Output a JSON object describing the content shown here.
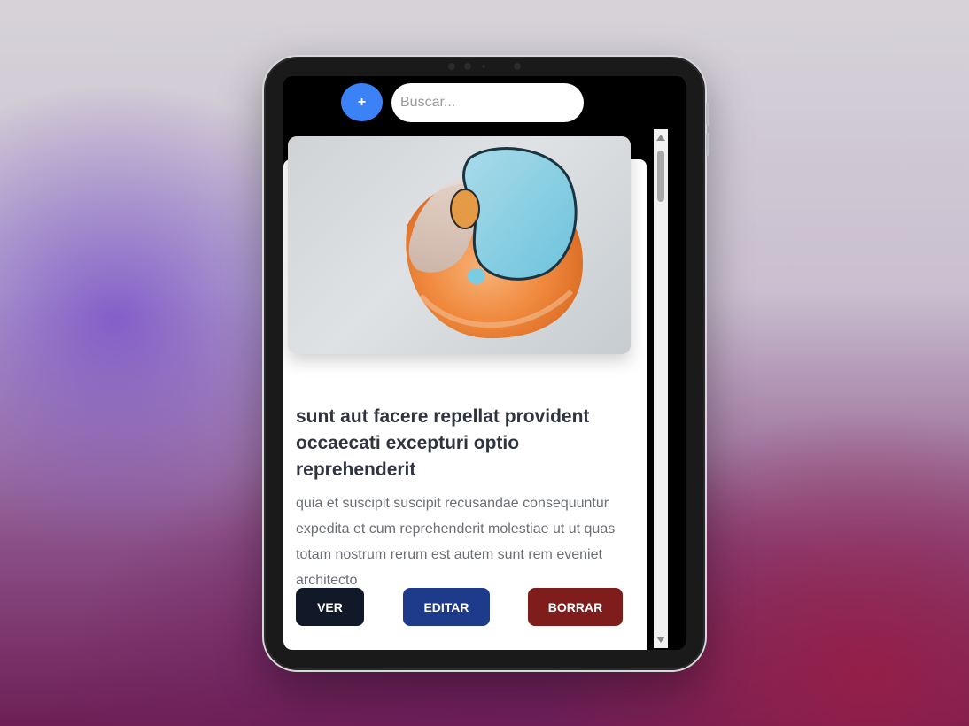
{
  "toolbar": {
    "add_label": "+",
    "search_placeholder": "Buscar..."
  },
  "post": {
    "title": "sunt aut facere repellat provident occaecati excepturi optio reprehenderit",
    "body": "quia et suscipit suscipit recusandae consequuntur expedita et cum reprehenderit molestiae ut ut quas totam nostrum rerum est autem sunt rem eveniet architecto",
    "actions": {
      "view": "VER",
      "edit": "EDITAR",
      "delete": "BORRAR"
    }
  },
  "colors": {
    "accent": "#3b82f6",
    "view": "#111827",
    "edit": "#1e3a8a",
    "delete": "#7f1d1d"
  }
}
